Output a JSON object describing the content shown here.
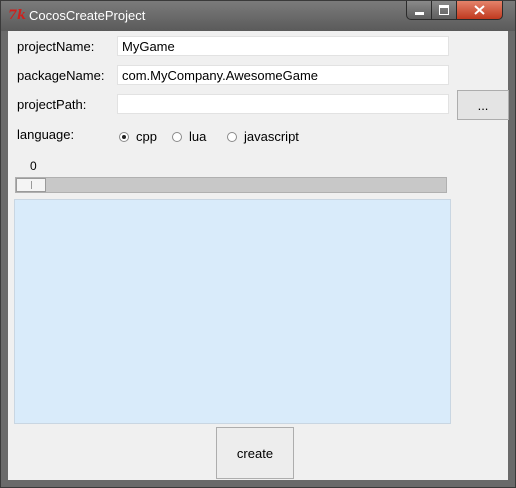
{
  "window": {
    "title": "CocosCreateProject",
    "app_icon_glyph": "7k"
  },
  "form": {
    "project_name": {
      "label": "projectName:",
      "value": "MyGame"
    },
    "package_name": {
      "label": "packageName:",
      "value": "com.MyCompany.AwesomeGame"
    },
    "project_path": {
      "label": "projectPath:",
      "value": ""
    },
    "browse_label": "..."
  },
  "language": {
    "label": "language:",
    "options": [
      "cpp",
      "lua",
      "javascript"
    ],
    "selected": "cpp"
  },
  "progress": {
    "value_label": "0",
    "value": 0
  },
  "actions": {
    "create_label": "create"
  },
  "colors": {
    "log_background": "#d9ebfa",
    "close_button": "#c0391f"
  }
}
